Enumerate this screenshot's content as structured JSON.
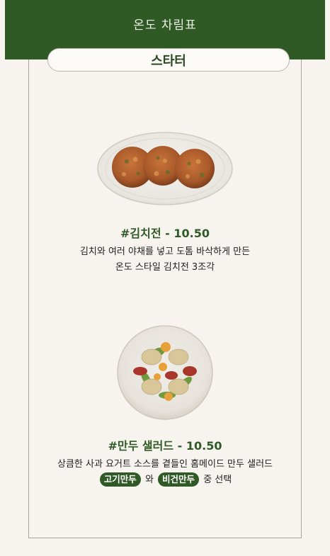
{
  "header": {
    "title": "온도 차림표"
  },
  "section": {
    "title": "스타터"
  },
  "dishes": [
    {
      "name": "#김치전 - 10.50",
      "desc_line1": "김치와 여러 야채를 넣고 도톰 바삭하게 만든",
      "desc_line2": "온도 스타일 김치전 3조각"
    },
    {
      "name": "#만두 샐러드 - 10.50",
      "desc_line1": "상큼한 사과 요거트 소스를 곁들인 홈메이드 만두 샐러드",
      "option1": "고기만두",
      "conj": "와",
      "option2": "비건만두",
      "suffix": "중 선택"
    }
  ],
  "colors": {
    "brand_green": "#2f5a25",
    "background": "#f7f4ef"
  }
}
